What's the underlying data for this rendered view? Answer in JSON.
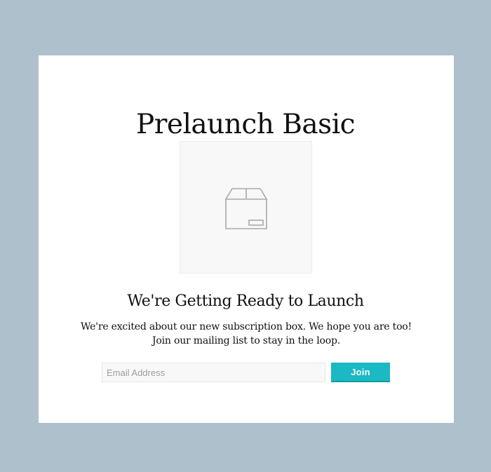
{
  "page": {
    "title": "Prelaunch Basic",
    "subtitle": "We're Getting Ready to Launch",
    "description": "We're excited about our new subscription box. We hope you are too! Join our mailing list to stay in the loop."
  },
  "product_image": {
    "icon": "box-icon"
  },
  "signup_form": {
    "email_placeholder": "Email Address",
    "email_value": "",
    "join_label": "Join"
  },
  "colors": {
    "page_background": "#adc0cb",
    "card_background": "#ffffff",
    "accent": "#1ab9c4",
    "text": "#111111"
  }
}
